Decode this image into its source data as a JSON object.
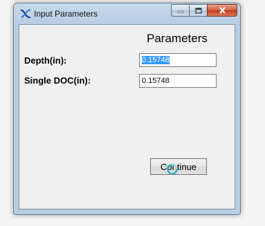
{
  "window": {
    "title": "Input Parameters",
    "app_icon": "app-logo-icon",
    "controls": [
      "minimize-icon",
      "maximize-icon",
      "close-icon"
    ]
  },
  "form": {
    "heading": "Parameters",
    "depth_label": "Depth(in):",
    "depth_value": "0.15748",
    "doc_label": "Single DOC(in):",
    "doc_value": "0.15748",
    "continue_label": "Continue"
  },
  "colors": {
    "selection": "#3399ff",
    "close_button": "#c8462b",
    "frame": "#b7cde3"
  },
  "cursor": "busy-cursor-icon"
}
